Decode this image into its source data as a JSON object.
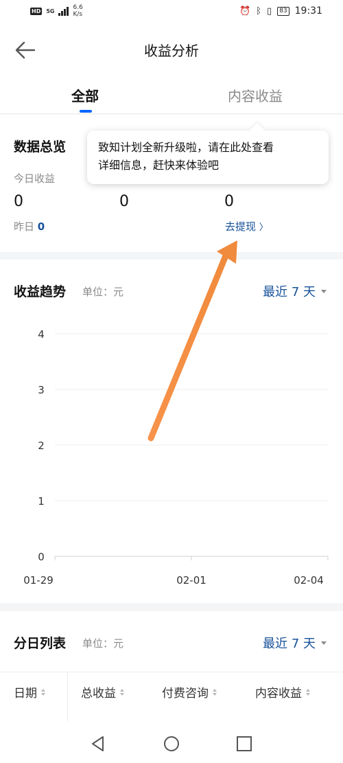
{
  "status_bar": {
    "network_badge": "HD",
    "network_type": "5G",
    "speed_value": "6.6",
    "speed_unit": "K/s",
    "battery": "83",
    "time": "19:31"
  },
  "header": {
    "title": "收益分析",
    "back_icon": "back-arrow-icon"
  },
  "tabs": [
    {
      "label": "全部",
      "active": true
    },
    {
      "label": "内容收益",
      "active": false
    }
  ],
  "overview": {
    "title": "数据总览",
    "today_label": "今日收益",
    "values": [
      "0",
      "0",
      "0"
    ],
    "yesterday_label": "昨日",
    "yesterday_value": "0",
    "withdraw_label": "去提现"
  },
  "tooltip": {
    "text_line1": "致知计划全新升级啦，请在此处查看",
    "text_line2": "详细信息，赶快来体验吧"
  },
  "trend": {
    "title": "收益趋势",
    "unit": "单位：元",
    "range": "最近 7 天"
  },
  "chart_data": {
    "type": "line",
    "title": "",
    "x": [
      "01-29",
      "02-01",
      "02-04"
    ],
    "y_ticks": [
      "0",
      "1",
      "2",
      "3",
      "4"
    ],
    "ylim": [
      0,
      4
    ],
    "series": [],
    "grid": true,
    "xlabel": "",
    "ylabel": ""
  },
  "daily": {
    "title": "分日列表",
    "unit": "单位：元",
    "range": "最近 7 天",
    "columns": [
      "日期",
      "总收益",
      "付费咨询",
      "内容收益"
    ]
  },
  "nav": {
    "back_icon": "triangle-back-icon",
    "home_icon": "circle-home-icon",
    "recent_icon": "square-recent-icon"
  },
  "colors": {
    "accent_blue": "#0066ff",
    "link_blue": "#175199",
    "annotation_orange": "#f7934a"
  }
}
